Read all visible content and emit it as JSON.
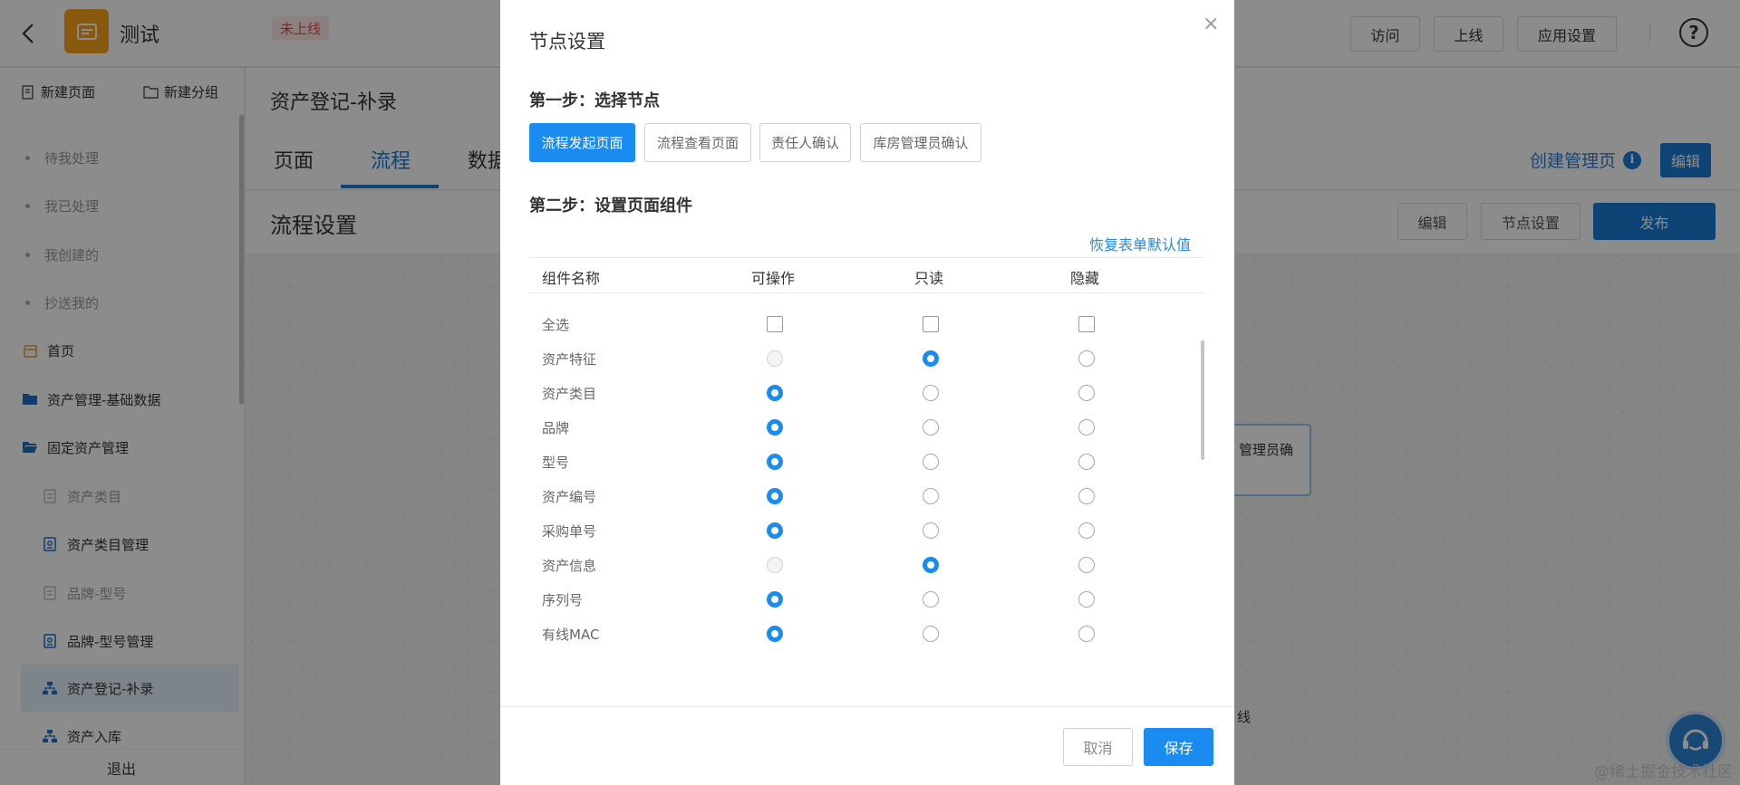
{
  "app": {
    "name": "测试",
    "status": "未上线",
    "top_buttons": [
      "访问",
      "上线",
      "应用设置"
    ],
    "help": "?"
  },
  "sidebar": {
    "new_page": "新建页面",
    "new_group": "新建分组",
    "items": [
      {
        "label": "待我处理"
      },
      {
        "label": "我已处理"
      },
      {
        "label": "我创建的"
      },
      {
        "label": "抄送我的"
      },
      {
        "label": "首页"
      },
      {
        "label": "资产管理-基础数据"
      },
      {
        "label": "固定资产管理"
      },
      {
        "label": "资产类目"
      },
      {
        "label": "资产类目管理"
      },
      {
        "label": "品牌-型号"
      },
      {
        "label": "品牌-型号管理"
      },
      {
        "label": "资产登记-补录"
      },
      {
        "label": "资产入库"
      }
    ],
    "footer": "退出"
  },
  "main": {
    "title": "资产登记-补录",
    "tabs": [
      "页面",
      "流程",
      "数据"
    ],
    "create_link": "创建管理页",
    "edit_label": "编辑",
    "sub_title": "流程设置",
    "sub_buttons": [
      "编辑",
      "节点设置",
      "发布"
    ],
    "canvas_node": "管理员确",
    "canvas_label": "线"
  },
  "modal": {
    "title": "节点设置",
    "close": "×",
    "step1": "第一步：选择节点",
    "nodes": [
      "流程发起页面",
      "流程查看页面",
      "责任人确认",
      "库房管理员确认"
    ],
    "active_node": 0,
    "step2": "第二步：设置页面组件",
    "restore": "恢复表单默认值",
    "columns": [
      "组件名称",
      "可操作",
      "只读",
      "隐藏"
    ],
    "select_all": "全选",
    "rows": [
      {
        "name": "资产特征",
        "state": "readonly",
        "operable_disabled": true
      },
      {
        "name": "资产类目",
        "state": "operable"
      },
      {
        "name": "品牌",
        "state": "operable"
      },
      {
        "name": "型号",
        "state": "operable"
      },
      {
        "name": "资产编号",
        "state": "operable"
      },
      {
        "name": "采购单号",
        "state": "operable"
      },
      {
        "name": "资产信息",
        "state": "readonly",
        "operable_disabled": true
      },
      {
        "name": "序列号",
        "state": "operable"
      },
      {
        "name": "有线MAC",
        "state": "operable"
      },
      {
        "name": "",
        "state": "operable"
      }
    ],
    "cancel": "取消",
    "save": "保存"
  },
  "watermark": "@稀土掘金技术社区",
  "colors": {
    "primary": "#1a8cf0",
    "accent_orange": "#f7a21b",
    "status_red": "#e64a4a"
  }
}
